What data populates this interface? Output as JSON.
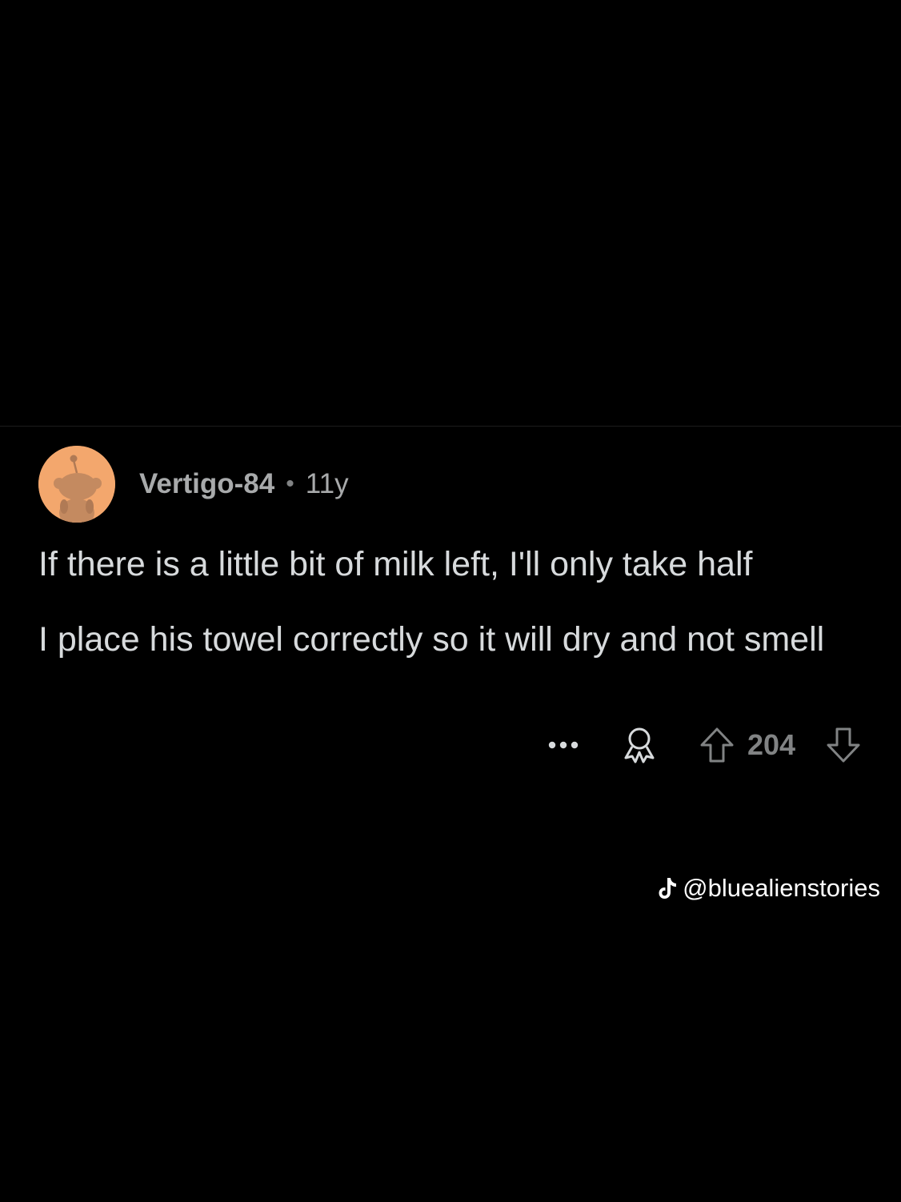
{
  "comment": {
    "username": "Vertigo-84",
    "separator": "•",
    "age": "11y",
    "paragraphs": [
      "If there is a little bit of milk left, I'll only take half",
      "I place his towel correctly so it will dry and not smell"
    ],
    "score": "204",
    "icons": {
      "avatar": "reddit-snoo-avatar",
      "more": "more-options-icon",
      "award": "award-icon",
      "upvote": "upvote-arrow-icon",
      "downvote": "downvote-arrow-icon"
    }
  },
  "watermark": {
    "icon": "tiktok-icon",
    "handle": "@bluealienstories"
  },
  "colors": {
    "background": "#000000",
    "avatar": "#f3a76d",
    "text": "#d7dadc",
    "muted": "#818384"
  }
}
